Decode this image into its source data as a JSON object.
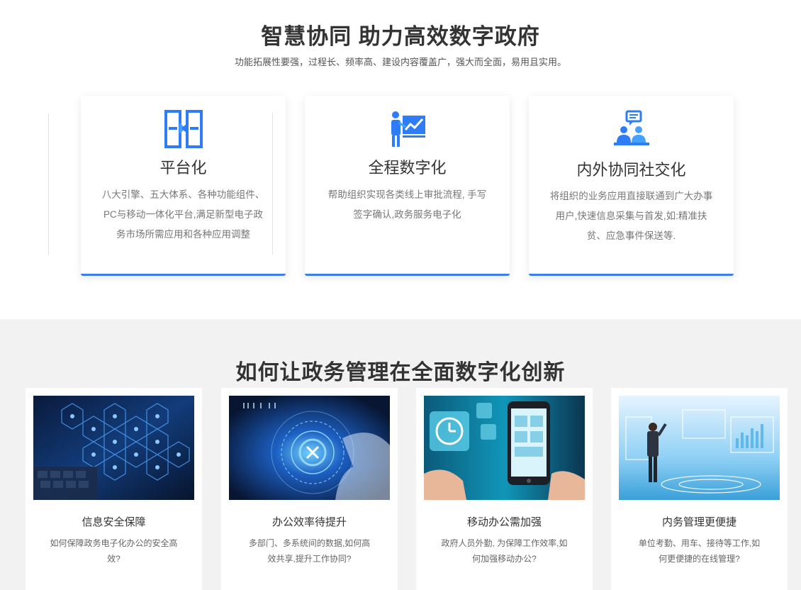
{
  "hero": {
    "title": "智慧协同 助力高效数字政府",
    "subtitle": "功能拓展性要强，过程长、频率高、建设内容覆盖广，强大而全面，易用且实用。"
  },
  "features": [
    {
      "icon": "platform-icon",
      "title": "平台化",
      "desc_lines": [
        "八大引擎、五大体系、各种功能组件、",
        "PC与移动一体化平台,满足新型电子政",
        "务市场所需应用和各种应用调整"
      ]
    },
    {
      "icon": "presentation-chart-icon",
      "title": "全程数字化",
      "desc_lines": [
        "帮助组织实现各类线上审批流程, 手写",
        "签字确认,政务服务电子化"
      ]
    },
    {
      "icon": "people-chat-icon",
      "title": "内外协同社交化",
      "desc_lines": [
        "将组织的业务应用直接联通到广大办事",
        "用户,快速信息采集与首发,如:精准扶",
        "贫、应急事件保送等."
      ]
    }
  ],
  "section": {
    "title": "如何让政务管理在全面数字化创新"
  },
  "cases": [
    {
      "title": "信息安全保障",
      "desc_lines": [
        "如何保障政务电子化办公的安全高",
        "效?"
      ]
    },
    {
      "title": "办公效率待提升",
      "desc_lines": [
        "多部门、多系统间的数据,如何高",
        "效共享,提升工作协同?"
      ]
    },
    {
      "title": "移动办公需加强",
      "desc_lines": [
        "政府人员外勤, 为保障工作效率,如",
        "何加强移动办公?"
      ]
    },
    {
      "title": "内务管理更便捷",
      "desc_lines": [
        "单位考勤、用车、接待等工作,如",
        "何更便捷的在线管理?"
      ]
    }
  ],
  "colors": {
    "accent": "#3d7eea",
    "icon_blue": "#2f7df6",
    "bottom_bg": "#f2f2f2"
  }
}
